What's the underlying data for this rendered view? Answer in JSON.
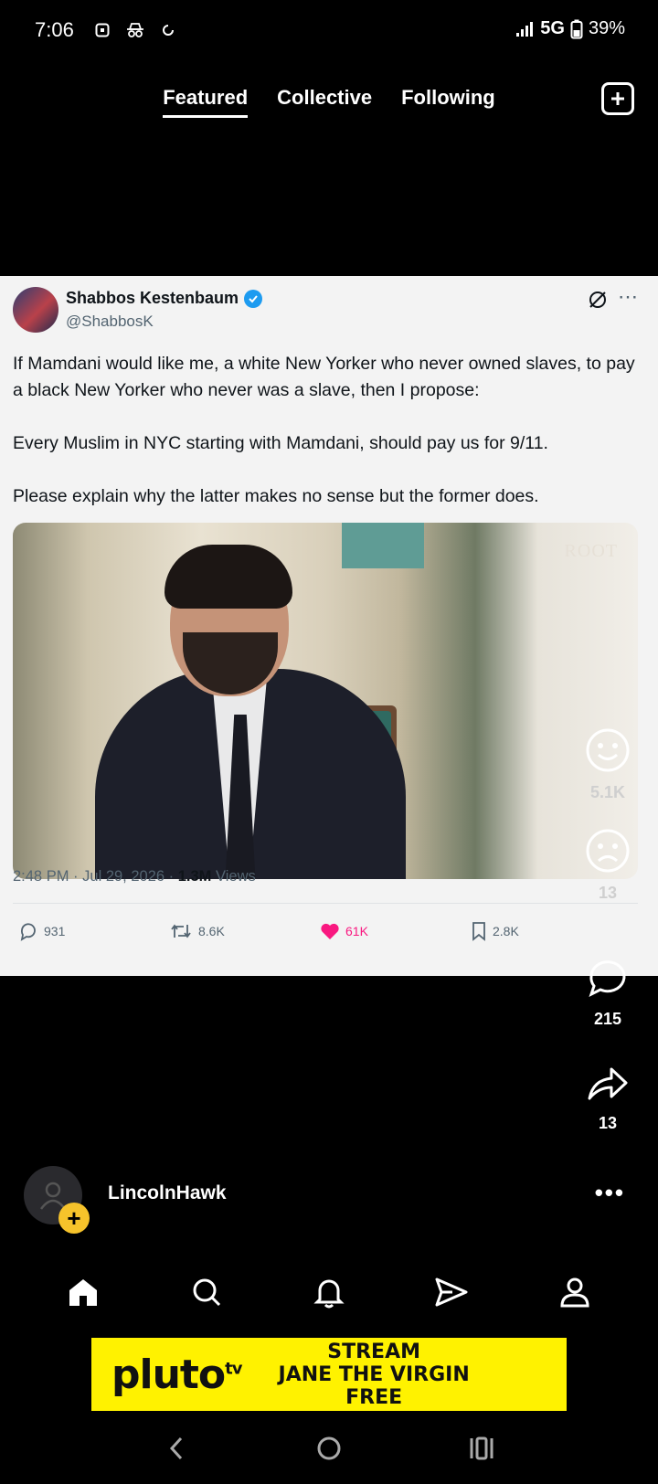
{
  "status_bar": {
    "time": "7:06",
    "network": "5G",
    "battery": "39%"
  },
  "tabs": [
    {
      "label": "Featured",
      "active": true
    },
    {
      "label": "Collective",
      "active": false
    },
    {
      "label": "Following",
      "active": false
    }
  ],
  "tweet": {
    "author_name": "Shabbos Kestenbaum",
    "handle": "@ShabbosK",
    "paragraphs": [
      "If Mamdani would like me, a white New Yorker who never owned slaves, to pay a black New Yorker who never was a slave, then I propose:",
      "Every Muslim in NYC starting with Mamdani, should pay us for 9/11.",
      "Please explain why the latter makes no sense but the former does."
    ],
    "media_watermark": "ROOT",
    "time": "2:48 PM",
    "date": "Jul 29, 2026",
    "views_count": "1.3M",
    "views_label": "Views",
    "replies": "931",
    "reposts": "8.6K",
    "likes": "61K",
    "bookmarks": "2.8K"
  },
  "rail": {
    "smile_count": "5.1K",
    "frown_count": "13",
    "comments_count": "215",
    "share_count": "13"
  },
  "author": {
    "username": "LincolnHawk"
  },
  "ad": {
    "brand": "pluto",
    "brand_sup": "tv",
    "line1": "STREAM",
    "line2": "JANE THE VIRGIN",
    "line3": "FREE"
  },
  "colors": {
    "accent_like": "#f91880",
    "verified": "#1d9bf0",
    "follow_badge": "#f6c32b",
    "ad_background": "#fff200"
  }
}
